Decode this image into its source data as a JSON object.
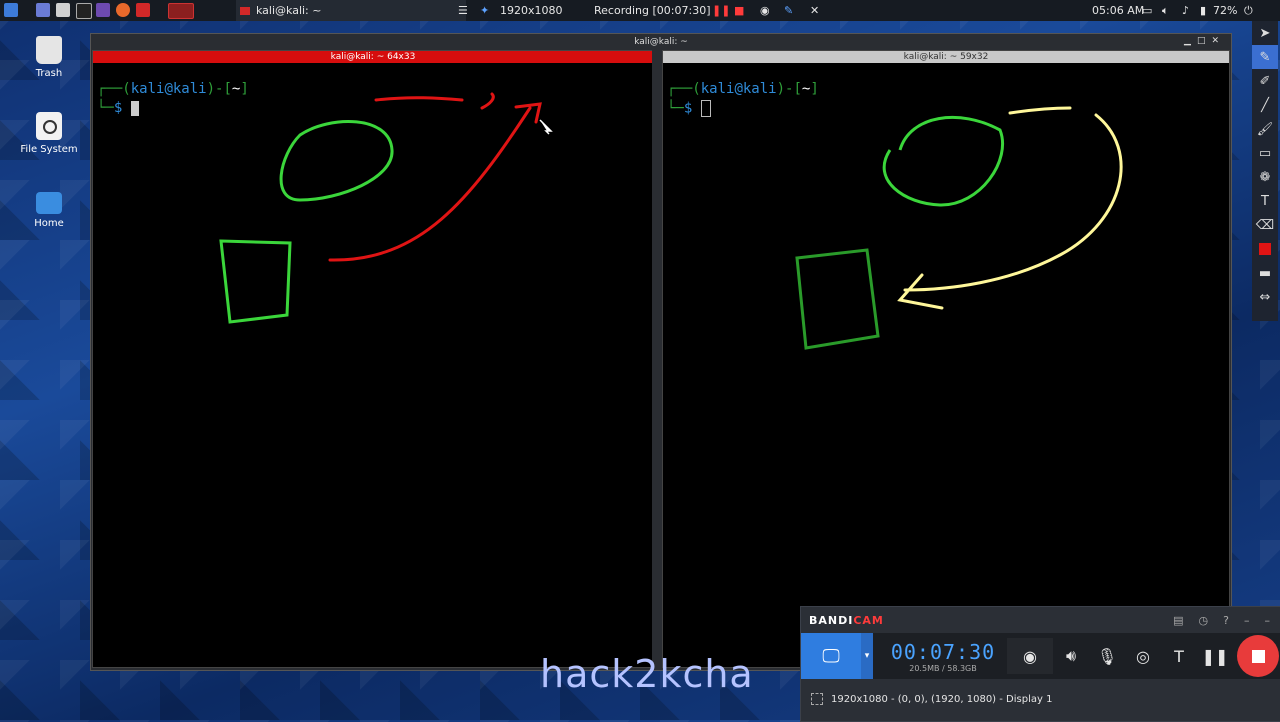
{
  "taskbar": {
    "window_label": "kali@kali: ~",
    "resolution": "1920x1080",
    "recording": "Recording [00:07:30]",
    "clock": "05:06 AM",
    "battery": "72%"
  },
  "desktop": {
    "icons": [
      {
        "label": "Trash",
        "icon": "trash-icon"
      },
      {
        "label": "File System",
        "icon": "disk-icon"
      },
      {
        "label": "Home",
        "icon": "home-folder-icon"
      }
    ]
  },
  "window": {
    "title": "kali@kali: ~",
    "left_pane_title": "kali@kali: ~ 64x33",
    "right_pane_title": "kali@kali: ~ 59x32",
    "prompt": {
      "user": "kali",
      "at_symbol": "@",
      "host": "kali",
      "dir": "~",
      "symbol": "$"
    }
  },
  "drawings": {
    "left_ellipse": "#3bd63b",
    "left_rect": "#3bd63b",
    "left_arrow": "#e01414",
    "right_ellipse": "#3bd63b",
    "right_rect": "#2a9b2a",
    "right_arrow": "#fff79a"
  },
  "bandicam": {
    "brand_a": "BANDI",
    "brand_b": "CAM",
    "time": "00:07:30",
    "size": "20.5MB / 58.3GB",
    "region_info": "1920x1080 - (0, 0), (1920, 1080) - Display 1"
  },
  "watermark": "hack2kcha"
}
